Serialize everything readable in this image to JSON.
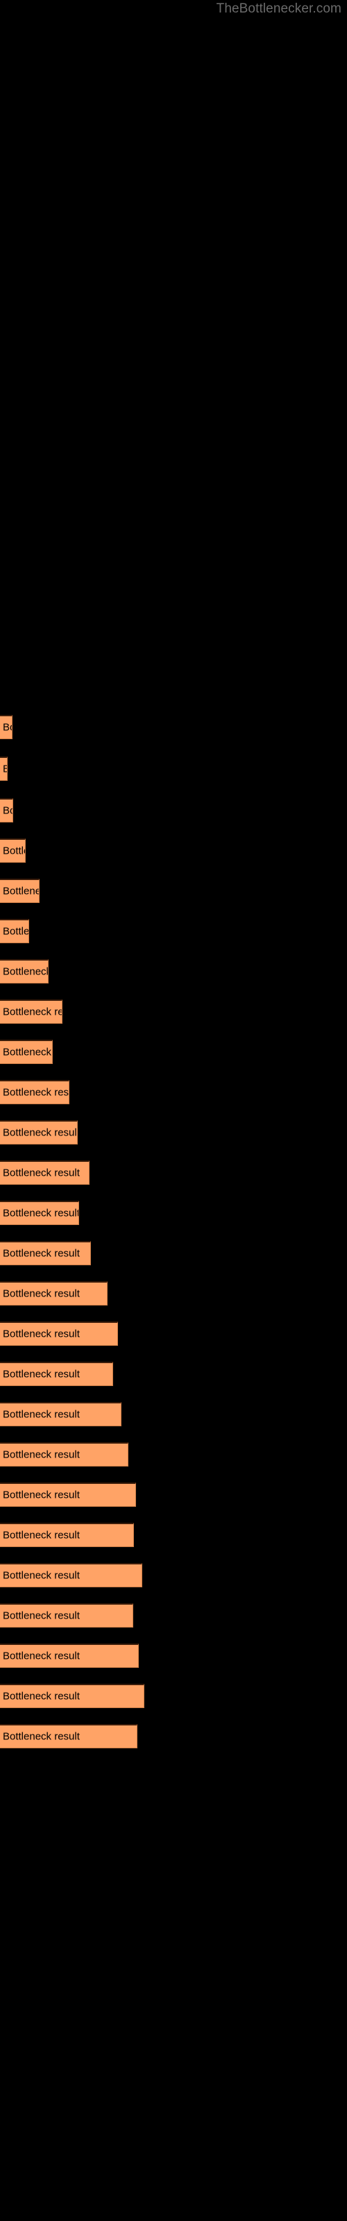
{
  "watermark": "TheBottlenecker.com",
  "chart_data": {
    "type": "bar",
    "orientation": "horizontal",
    "title": "",
    "subtitle": "",
    "xlabel": "",
    "ylabel": "",
    "grid": false,
    "legend": null,
    "background_color": "#000000",
    "bar_color": "#ffa366",
    "bar_edge_color": "#3a1c0a",
    "label_color": "#000000",
    "watermark_color": "#6b6b6b",
    "bar_label_text": "Bottleneck result",
    "categories": [
      "Bottleneck result",
      "Bottleneck result",
      "Bottleneck result",
      "Bottleneck result",
      "Bottleneck result",
      "Bottleneck result",
      "Bottleneck result",
      "Bottleneck result",
      "Bottleneck result",
      "Bottleneck result",
      "Bottleneck result",
      "Bottleneck result",
      "Bottleneck result",
      "Bottleneck result",
      "Bottleneck result",
      "Bottleneck result",
      "Bottleneck result",
      "Bottleneck result",
      "Bottleneck result",
      "Bottleneck result",
      "Bottleneck result",
      "Bottleneck result",
      "Bottleneck result",
      "Bottleneck result",
      "Bottleneck result",
      "Bottleneck result"
    ],
    "values": [
      18,
      11,
      19,
      37,
      57,
      42,
      70,
      90,
      76,
      100,
      112,
      129,
      114,
      131,
      155,
      170,
      163,
      175,
      185,
      196,
      193,
      205,
      192,
      200,
      208,
      198
    ],
    "xlim": [
      0,
      500
    ],
    "bar_tops": [
      1030,
      1090,
      1150,
      1208,
      1266,
      1324,
      1382,
      1440,
      1498,
      1556,
      1614,
      1672,
      1730,
      1788,
      1846,
      1904,
      1962,
      2020,
      2078,
      2136,
      2194,
      2252,
      2310,
      2368,
      2426,
      2484
    ]
  }
}
